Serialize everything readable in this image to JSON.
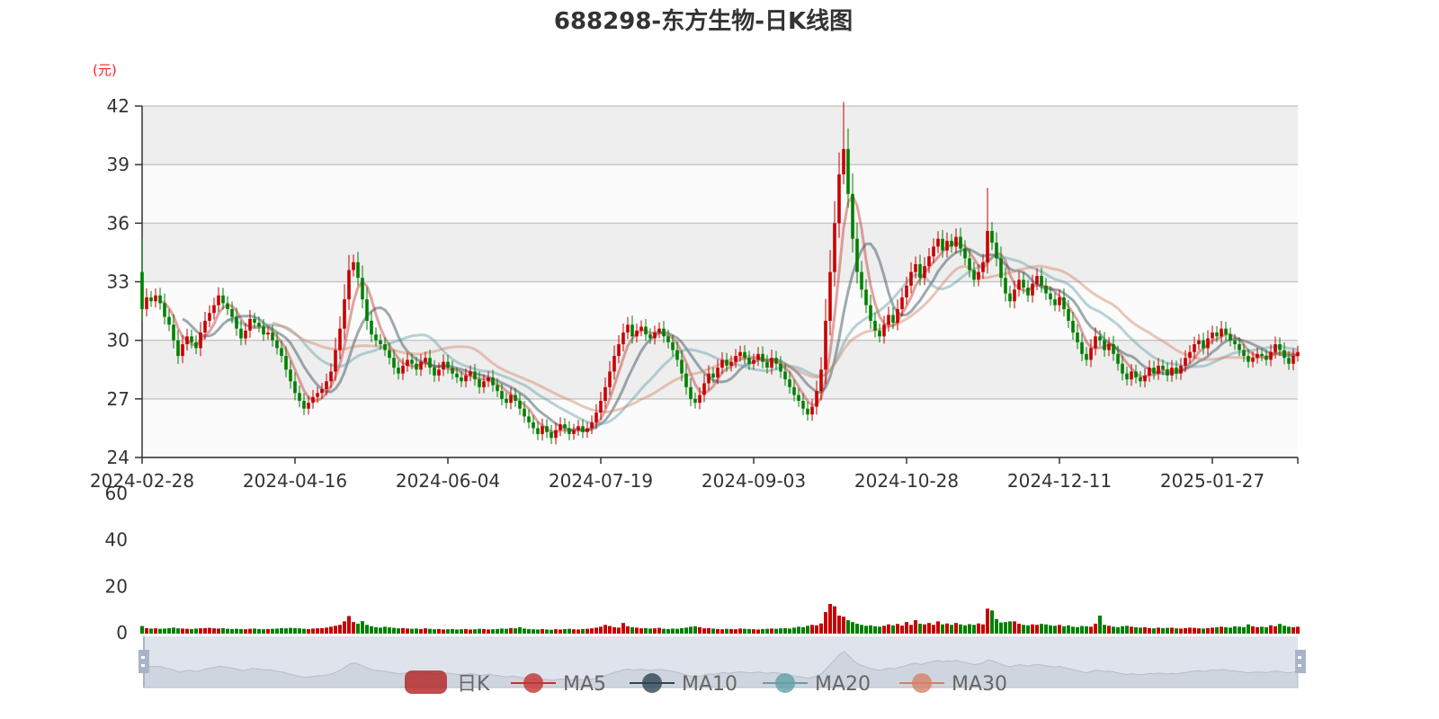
{
  "chart_data": {
    "type": "candlestick",
    "title": "688298-东方生物-日K线图",
    "ylabel": "(元)",
    "ylim": [
      24,
      42
    ],
    "yticks": [
      24,
      27,
      30,
      33,
      36,
      39,
      42
    ],
    "volume_ylim": [
      0,
      60
    ],
    "volume_yticks": [
      0,
      20,
      40,
      60
    ],
    "x_tick_labels": [
      "2024-02-28",
      "2024-04-16",
      "2024-06-04",
      "2024-07-19",
      "2024-09-03",
      "2024-10-28",
      "2024-12-11",
      "2025-01-27"
    ],
    "x_tick_step": 34,
    "legend": [
      "日K",
      "MA5",
      "MA10",
      "MA20",
      "MA30"
    ],
    "legend_position": "bottom",
    "colors": {
      "up": "#c80000",
      "down": "#008000",
      "MA5": "#c23531",
      "MA10": "#2f4554",
      "MA20": "#61a0a8",
      "MA30": "#d48265",
      "band": "#eeeeee",
      "axis_label_unit": "#ff2020"
    },
    "close": [
      31.6,
      32.2,
      32.0,
      32.3,
      31.9,
      31.2,
      30.8,
      30.0,
      29.2,
      29.8,
      30.2,
      29.9,
      29.6,
      30.4,
      31.0,
      31.4,
      31.8,
      32.3,
      31.9,
      31.6,
      31.2,
      30.6,
      30.1,
      30.5,
      31.1,
      30.9,
      30.7,
      30.3,
      30.4,
      30.0,
      29.6,
      29.2,
      28.5,
      27.9,
      27.3,
      26.9,
      26.5,
      26.8,
      27.1,
      27.3,
      27.5,
      27.9,
      28.4,
      29.5,
      30.6,
      32.1,
      33.6,
      34.0,
      33.2,
      32.1,
      31.0,
      30.3,
      30.0,
      29.8,
      29.5,
      29.1,
      28.6,
      28.3,
      28.7,
      29.0,
      28.8,
      28.5,
      28.9,
      29.1,
      28.6,
      28.2,
      28.5,
      28.9,
      28.6,
      28.3,
      28.1,
      27.9,
      28.2,
      28.4,
      28.0,
      27.6,
      27.9,
      28.1,
      27.7,
      27.4,
      27.0,
      26.8,
      27.2,
      26.9,
      26.5,
      26.1,
      25.8,
      25.5,
      25.2,
      25.6,
      25.3,
      25.0,
      25.4,
      25.7,
      25.5,
      25.2,
      25.4,
      25.6,
      25.3,
      25.5,
      25.8,
      26.3,
      26.9,
      27.6,
      28.4,
      29.2,
      29.8,
      30.4,
      30.8,
      30.2,
      30.5,
      30.7,
      30.3,
      30.1,
      30.4,
      30.6,
      30.2,
      29.9,
      29.5,
      29.0,
      28.3,
      27.6,
      27.0,
      26.8,
      27.2,
      27.8,
      28.3,
      28.1,
      28.6,
      29.0,
      28.7,
      28.9,
      29.2,
      29.4,
      29.1,
      28.8,
      29.0,
      29.3,
      28.9,
      28.6,
      29.1,
      28.8,
      28.4,
      28.0,
      27.6,
      27.2,
      26.9,
      26.5,
      26.2,
      26.6,
      27.4,
      28.5,
      31.0,
      33.5,
      36.0,
      38.5,
      39.8,
      37.5,
      35.2,
      33.5,
      32.6,
      31.8,
      31.0,
      30.5,
      30.2,
      30.8,
      31.3,
      30.9,
      31.6,
      32.2,
      32.8,
      33.5,
      33.9,
      33.2,
      33.8,
      34.3,
      34.8,
      35.2,
      34.6,
      35.1,
      34.8,
      35.3,
      34.7,
      34.2,
      33.6,
      33.1,
      33.5,
      34.0,
      35.6,
      35.0,
      34.2,
      33.2,
      32.4,
      32.0,
      32.6,
      33.1,
      32.7,
      32.3,
      32.9,
      33.3,
      32.8,
      32.4,
      32.1,
      31.8,
      32.2,
      31.6,
      31.0,
      30.4,
      29.9,
      29.3,
      29.0,
      29.6,
      30.2,
      30.0,
      29.5,
      29.8,
      29.3,
      28.8,
      28.3,
      28.0,
      28.4,
      28.1,
      27.9,
      28.2,
      28.6,
      28.3,
      28.7,
      28.5,
      28.2,
      28.6,
      28.3,
      28.7,
      29.1,
      29.4,
      29.8,
      30.0,
      29.6,
      30.1,
      30.4,
      30.2,
      30.6,
      30.3,
      30.0,
      29.8,
      29.5,
      29.2,
      28.9,
      29.1,
      29.3,
      29.2,
      29.0,
      29.4,
      29.8,
      29.5,
      29.1,
      28.8,
      29.2,
      29.4
    ],
    "volume": [
      2.5,
      1.6,
      1.4,
      1.5,
      1.3,
      1.4,
      1.6,
      1.8,
      1.5,
      1.4,
      1.3,
      1.2,
      1.4,
      1.5,
      1.6,
      1.7,
      1.5,
      1.4,
      1.6,
      1.3,
      1.2,
      1.3,
      1.2,
      1.1,
      1.3,
      1.4,
      1.2,
      1.1,
      1.2,
      1.3,
      1.4,
      1.6,
      1.5,
      1.7,
      1.6,
      1.5,
      1.3,
      1.2,
      1.4,
      1.5,
      1.6,
      1.8,
      2.2,
      2.6,
      3.0,
      4.5,
      6.8,
      4.2,
      3.5,
      4.6,
      3.0,
      2.4,
      2.0,
      1.8,
      2.2,
      1.9,
      1.7,
      1.5,
      1.6,
      1.4,
      1.3,
      1.4,
      1.2,
      1.5,
      1.3,
      1.1,
      1.2,
      1.0,
      1.1,
      1.2,
      1.0,
      1.1,
      1.2,
      1.0,
      1.1,
      1.3,
      1.2,
      1.0,
      1.1,
      1.2,
      1.4,
      1.3,
      1.6,
      1.5,
      2.0,
      1.4,
      1.2,
      1.1,
      1.0,
      1.2,
      1.0,
      0.9,
      1.1,
      1.0,
      1.2,
      1.3,
      1.1,
      1.0,
      1.2,
      1.3,
      1.5,
      1.8,
      2.2,
      3.0,
      2.5,
      2.0,
      1.8,
      3.8,
      2.4,
      2.0,
      1.8,
      1.5,
      1.6,
      1.4,
      1.5,
      1.7,
      1.3,
      1.2,
      1.4,
      1.3,
      1.6,
      1.8,
      2.2,
      2.4,
      2.0,
      1.5,
      1.6,
      1.4,
      1.2,
      1.1,
      1.3,
      1.2,
      1.1,
      1.4,
      1.3,
      1.2,
      1.1,
      1.0,
      1.2,
      1.3,
      1.4,
      1.3,
      1.5,
      1.6,
      1.4,
      1.8,
      2.2,
      2.0,
      2.6,
      3.0,
      2.8,
      3.6,
      8.5,
      12.0,
      11.0,
      7.0,
      6.5,
      5.0,
      4.2,
      3.5,
      3.0,
      2.6,
      2.8,
      2.4,
      2.2,
      2.6,
      3.2,
      2.8,
      3.4,
      2.7,
      4.2,
      3.0,
      5.0,
      3.5,
      3.2,
      3.8,
      3.0,
      4.5,
      3.2,
      3.6,
      3.0,
      3.8,
      3.2,
      2.8,
      3.3,
      3.0,
      3.6,
      3.2,
      10.0,
      9.2,
      5.5,
      4.0,
      4.2,
      4.5,
      4.5,
      3.5,
      3.0,
      2.8,
      3.2,
      3.0,
      3.4,
      3.2,
      2.8,
      2.6,
      3.0,
      2.4,
      2.8,
      2.2,
      2.0,
      2.5,
      2.4,
      2.2,
      3.5,
      7.0,
      3.0,
      2.6,
      2.2,
      2.0,
      2.4,
      2.6,
      2.2,
      2.0,
      1.8,
      2.0,
      1.6,
      1.5,
      1.8,
      1.6,
      1.7,
      1.8,
      1.5,
      1.4,
      1.6,
      1.8,
      1.7,
      1.5,
      1.4,
      1.6,
      1.8,
      2.0,
      2.2,
      2.0,
      1.8,
      2.4,
      2.2,
      2.0,
      3.2,
      2.4,
      2.0,
      2.2,
      2.0,
      2.8,
      2.4,
      3.4,
      2.6,
      2.2,
      2.0,
      2.2
    ]
  }
}
